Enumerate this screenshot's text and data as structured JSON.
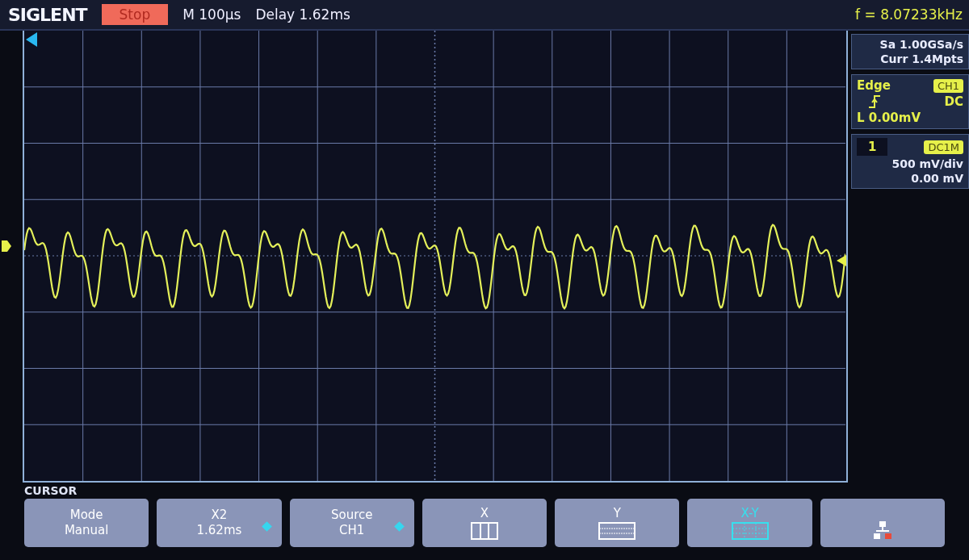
{
  "header": {
    "brand": "SIGLENT",
    "run_state": "Stop",
    "timebase": "M 100µs",
    "delay": "Delay 1.62ms",
    "frequency": "f = 8.07233kHz"
  },
  "acquisition": {
    "sample_rate": "Sa 1.00GSa/s",
    "memory_depth": "Curr 1.4Mpts"
  },
  "trigger": {
    "type": "Edge",
    "source": "CH1",
    "coupling": "DC",
    "level": "L 0.00mV"
  },
  "channel": {
    "number": "1",
    "coupling": "DC1M",
    "scale": "500 mV/div",
    "offset": "0.00 mV"
  },
  "menu": {
    "title": "CURSOR",
    "keys": [
      {
        "kind": "text",
        "title": "Mode",
        "value": "Manual",
        "adjustable": false,
        "selected": false
      },
      {
        "kind": "text",
        "title": "X2",
        "value": "1.62ms",
        "adjustable": true,
        "selected": false
      },
      {
        "kind": "text",
        "title": "Source",
        "value": "CH1",
        "adjustable": true,
        "selected": false
      },
      {
        "kind": "x-grid",
        "title": "X",
        "selected": false
      },
      {
        "kind": "y-grid",
        "title": "Y",
        "selected": false
      },
      {
        "kind": "xy-grid",
        "title": "X-Y",
        "selected": true
      },
      {
        "kind": "network",
        "selected": false
      }
    ]
  }
}
